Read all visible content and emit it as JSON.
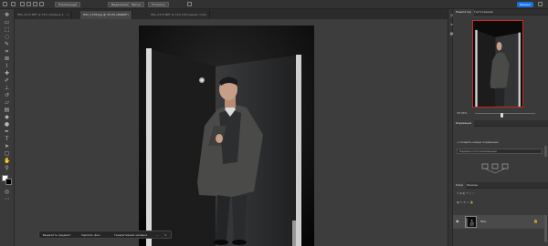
{
  "app": {
    "accent_color": "#1473e6",
    "selection_color": "#c62828"
  },
  "options_bar": {
    "mode_value": "Нормальный",
    "buttons": [
      "Выделение",
      "Маска",
      "Уточнить"
    ],
    "share_label": "Шеринг"
  },
  "document_tabs": [
    {
      "label": "IMG_0473.NEF @ 16% (Кривые 1, ...)",
      "active": false
    },
    {
      "label": "DSC_1703.jpg @ 33,3% (RGB/8*)",
      "active": true
    },
    {
      "label": "IMG_0474.NEF @ 16% (Исходный слой)",
      "active": false
    }
  ],
  "toolbar": {
    "tools": [
      "move-tool-icon",
      "artboard-tool-icon",
      "marquee-tool-icon",
      "lasso-tool-icon",
      "quick-select-tool-icon",
      "crop-tool-icon",
      "frame-tool-icon",
      "eyedropper-tool-icon",
      "healing-brush-tool-icon",
      "brush-tool-icon",
      "clone-stamp-tool-icon",
      "history-brush-tool-icon",
      "eraser-tool-icon",
      "gradient-tool-icon",
      "blur-tool-icon",
      "dodge-tool-icon",
      "pen-tool-icon",
      "type-tool-icon",
      "path-select-tool-icon",
      "shape-tool-icon",
      "hand-tool-icon",
      "zoom-tool-icon",
      "more-tools-icon"
    ],
    "foreground_color": "#ffffff",
    "background_color": "#000000"
  },
  "contextual_taskbar": {
    "items": [
      "Выделить предмет",
      "Удалить фон",
      "Генеративная заливка"
    ]
  },
  "right_panel": {
    "navigator_tabs": [
      "Навигатор",
      "Гистограмма"
    ],
    "zoom_value": "33,33%",
    "zoom_level": 0.42,
    "adjustments_title": "Коррекция",
    "adjustments_add_label": "Создать новую коррекцию",
    "adjustments_field": "Недавно использованные",
    "layers_tabs": [
      "Слои",
      "Каналы"
    ],
    "layer_name": "Фон"
  }
}
